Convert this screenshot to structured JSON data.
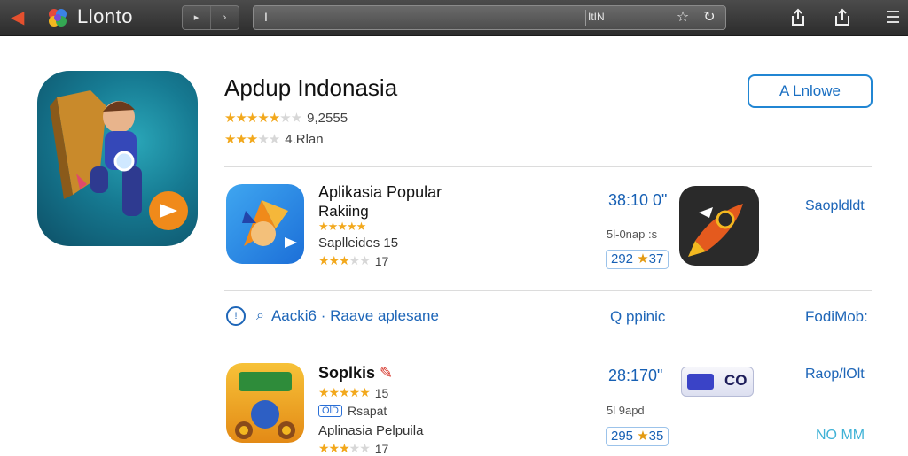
{
  "window": {
    "title": "Llonto",
    "nav_prev": "▸",
    "nav_next": "›",
    "url_cursor": "I",
    "url_text": "ItIN"
  },
  "hero": {
    "title": "Apdup Indonasia",
    "rating1_count": "9,2555",
    "rating1_stars": 4.5,
    "rating2_text": "4.Rlan",
    "rating2_stars": 3,
    "action_button": "A Lnlowe"
  },
  "apps": [
    {
      "name_line1": "Aplikasia Popular",
      "name_line2": "Rakiing",
      "stars": 5,
      "meta": "Saplleides 15",
      "rating2": "17",
      "price": "38:10 0\"",
      "sub": "5l-0nap :s",
      "badge_left": "292",
      "badge_right": "37",
      "link": "Saopldldt"
    },
    {
      "name_line1": "Soplkis",
      "stars_count": "15",
      "tag": "OlD",
      "tag_text": "Rsapat",
      "meta": "Aplinasia Pelpuila",
      "rating2": "17",
      "price": "28:170\"",
      "sub": "5l 9apd",
      "badge_left": "295",
      "badge_right": "35",
      "link": "Raop/lOlt",
      "link2": "NO MM",
      "co_text": "CO"
    }
  ],
  "filter": {
    "label": "Aacki6 · Raave aplesane",
    "mid": "Q ppinic",
    "right": "FodiMob:"
  },
  "colors": {
    "accent": "#1e66b8",
    "star": "#f2a81c",
    "topbar": "#3a3a3a"
  }
}
